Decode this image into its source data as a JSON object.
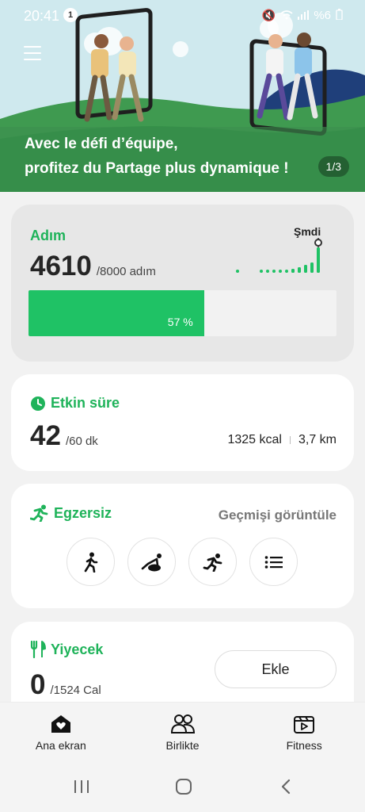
{
  "status": {
    "time": "20:41",
    "notification_count": "1",
    "battery": "%6"
  },
  "banner": {
    "line1": "Avec le défi d’équipe,",
    "line2": "profitez du Partage plus dynamique !",
    "pager": "1/3"
  },
  "steps": {
    "title": "Adım",
    "count": "4610",
    "goal": "/8000 adım",
    "now_label": "Şmdi",
    "progress_fraction": 0.57,
    "progress_label": "57 %",
    "accent": "#1fc265"
  },
  "active_time": {
    "title": "Etkin süre",
    "minutes": "42",
    "goal": "/60 dk",
    "kcal": "1325 kcal",
    "distance": "3,7 km"
  },
  "exercise": {
    "title": "Egzersiz",
    "history": "Geçmişi görüntüle",
    "buttons": [
      "walk-icon",
      "yoga-icon",
      "run-icon",
      "list-icon"
    ]
  },
  "food": {
    "title": "Yiyecek",
    "calories": "0",
    "goal": "/1524 Cal",
    "add_label": "Ekle"
  },
  "bottom_nav": {
    "home": "Ana ekran",
    "together": "Birlikte",
    "fitness": "Fitness"
  }
}
